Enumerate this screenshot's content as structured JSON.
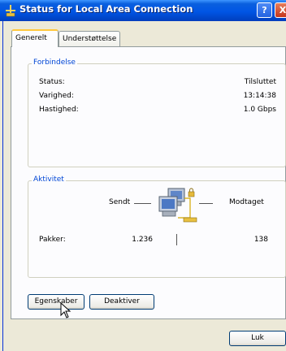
{
  "window": {
    "title": "Status for Local Area Connection"
  },
  "titlebar": {
    "help_glyph": "?",
    "close_glyph": "X",
    "colors": {
      "bar": "#0055e5",
      "close": "#c4351c"
    }
  },
  "tabs": [
    {
      "label": "Generelt",
      "active": true
    },
    {
      "label": "Understøttelse",
      "active": false
    }
  ],
  "connection": {
    "legend": "Forbindelse",
    "rows": [
      {
        "label": "Status:",
        "value": "Tilsluttet"
      },
      {
        "label": "Varighed:",
        "value": "13:14:38"
      },
      {
        "label": "Hastighed:",
        "value": "1.0 Gbps"
      }
    ]
  },
  "activity": {
    "legend": "Aktivitet",
    "sent_label": "Sendt",
    "received_label": "Modtaget",
    "packets_label": "Pakker:",
    "packets_sent": "1.236",
    "packets_received": "138",
    "icon": "network-computers-icon"
  },
  "buttons": {
    "properties": "Egenskaber",
    "disable": "Deaktiver",
    "close": "Luk"
  },
  "accent_color": "#0046d5"
}
